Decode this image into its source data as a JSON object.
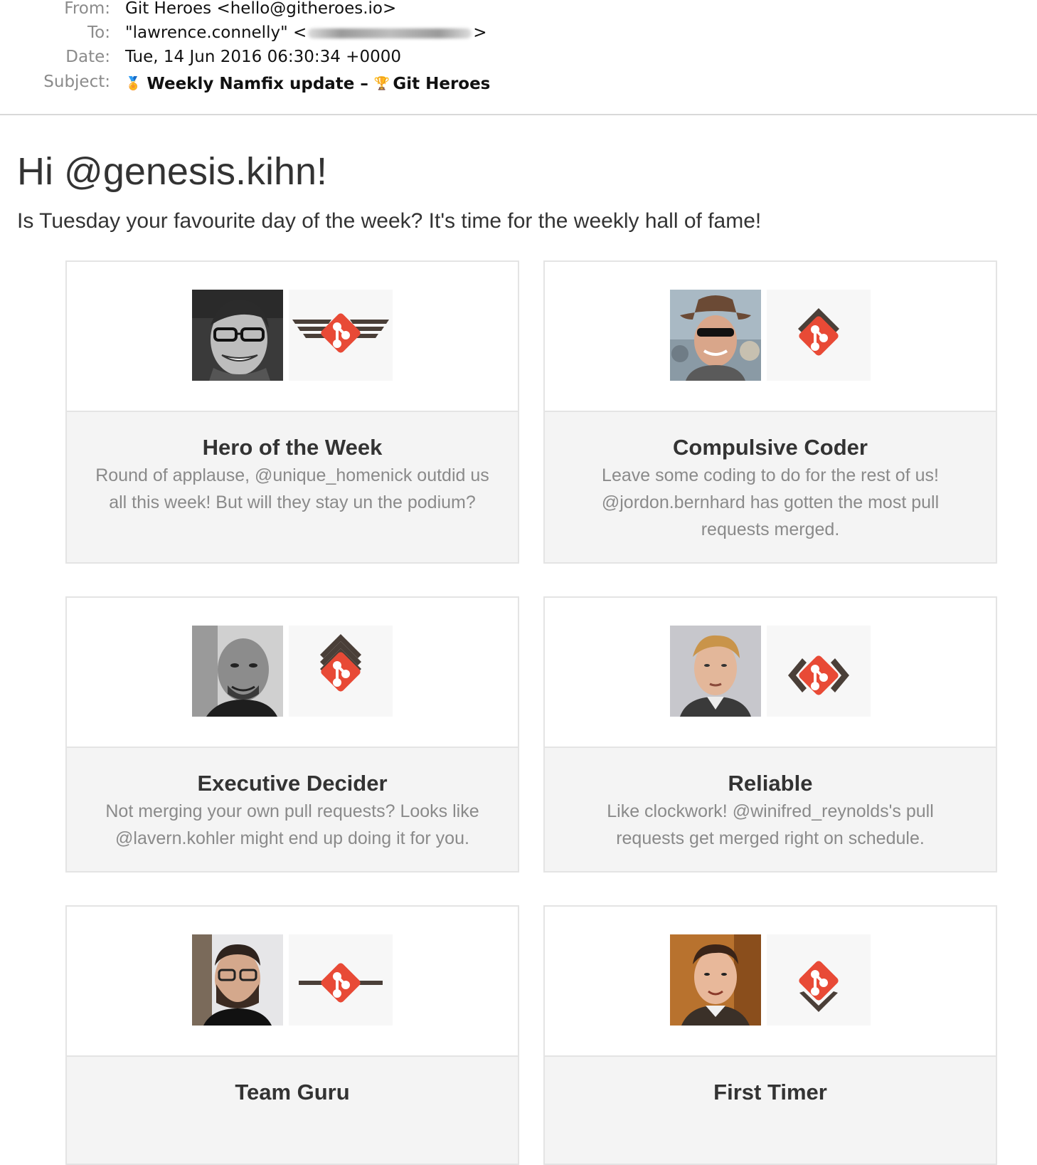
{
  "email": {
    "from_label": "From:",
    "from_value": "Git Heroes <hello@githeroes.io>",
    "to_label": "To:",
    "to_prefix": "\"lawrence.connelly\" <",
    "to_suffix": ">",
    "date_label": "Date:",
    "date_value": "Tue, 14 Jun 2016 06:30:34 +0000",
    "subject_label": "Subject:",
    "subject_icon_medal": "🏅",
    "subject_main": "Weekly Namfix update –",
    "subject_icon_trophy": "🏆",
    "subject_brand": "Git Heroes"
  },
  "greeting": "Hi @genesis.kihn!",
  "intro": "Is Tuesday your favourite day of the week? It's time for the weekly hall of fame!",
  "colors": {
    "accent": "#e84a36",
    "chevron": "#4a3f38"
  },
  "cards": [
    {
      "title": "Hero of the Week",
      "description": "Round of applause, @unique_homenick outdid us all this week! But will they stay un the podium?",
      "badge_icon": "winged-git-badge-icon"
    },
    {
      "title": "Compulsive Coder",
      "description": "Leave some coding to do for the rest of us! @jordon.bernhard has gotten the most pull requests merged.",
      "badge_icon": "chevron-git-badge-icon"
    },
    {
      "title": "Executive Decider",
      "description": "Not merging your own pull requests? Looks like @lavern.kohler might end up doing it for you.",
      "badge_icon": "triple-chevron-git-badge-icon"
    },
    {
      "title": "Reliable",
      "description": "Like clockwork! @winifred_reynolds's pull requests get merged right on schedule.",
      "badge_icon": "diamond-git-badge-icon"
    },
    {
      "title": "Team Guru",
      "description": "",
      "badge_icon": "lines-git-badge-icon"
    },
    {
      "title": "First Timer",
      "description": "",
      "badge_icon": "corner-git-badge-icon"
    }
  ]
}
